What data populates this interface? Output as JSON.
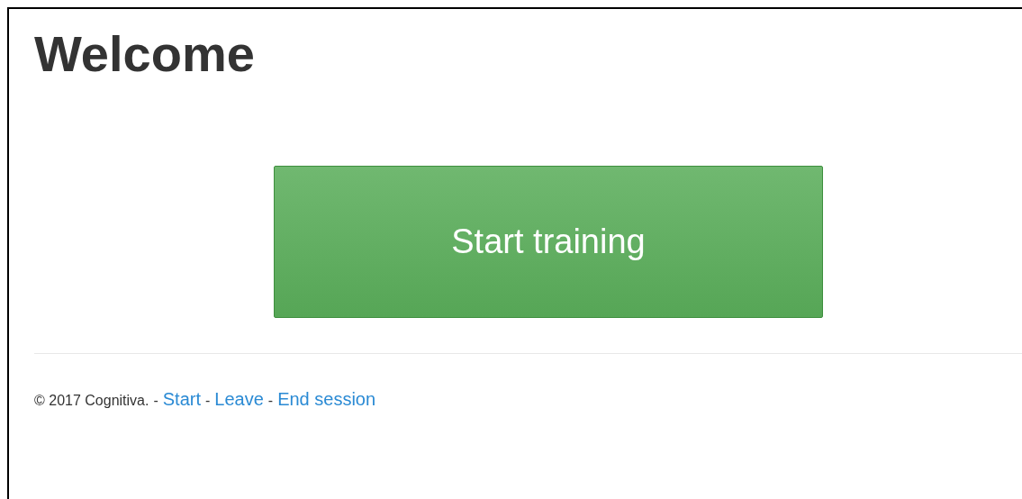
{
  "heading": "Welcome",
  "primary_button": {
    "label": "Start training"
  },
  "footer": [
    {
      "kind": "text",
      "text": "© 2017 Cognitiva."
    },
    {
      "kind": "separator",
      "text": "-"
    },
    {
      "kind": "link",
      "text": "Start"
    },
    {
      "kind": "separator",
      "text": "-"
    },
    {
      "kind": "link",
      "text": "Leave"
    },
    {
      "kind": "separator",
      "text": "-"
    },
    {
      "kind": "link",
      "text": "End session"
    }
  ]
}
